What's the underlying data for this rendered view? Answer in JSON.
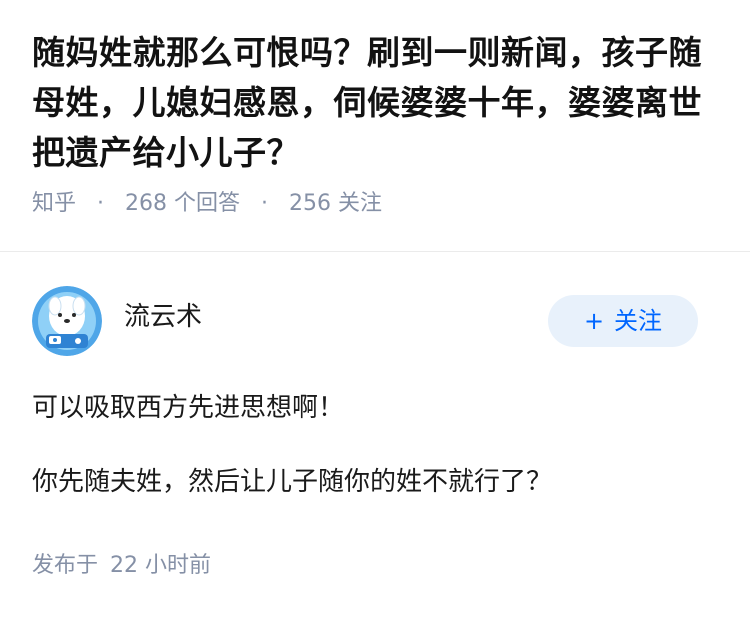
{
  "question": {
    "title": "随妈姓就那么可恨吗？刷到一则新闻，孩子随母姓，儿媳妇感恩，伺候婆婆十年，婆婆离世把遗产给小儿子？",
    "source": "知乎",
    "separator": "·",
    "answer_count": "268 个回答",
    "follower_count": "256 关注"
  },
  "answer": {
    "author": {
      "name": "流云术",
      "avatar_icon": "cartoon-dog-astronaut-avatar",
      "follow_label": "关注",
      "follow_icon": "+"
    },
    "paragraphs": [
      "可以吸取西方先进思想啊！",
      "你先随夫姓，然后让儿子随你的姓不就行了？"
    ],
    "time_prefix": "发布于",
    "time_ago": "22 小时前"
  },
  "colors": {
    "text": "#1a1a1a",
    "meta": "#8590a6",
    "follow_bg": "#e8f1fb",
    "follow_text": "#0066ff",
    "divider": "#ebebeb"
  }
}
